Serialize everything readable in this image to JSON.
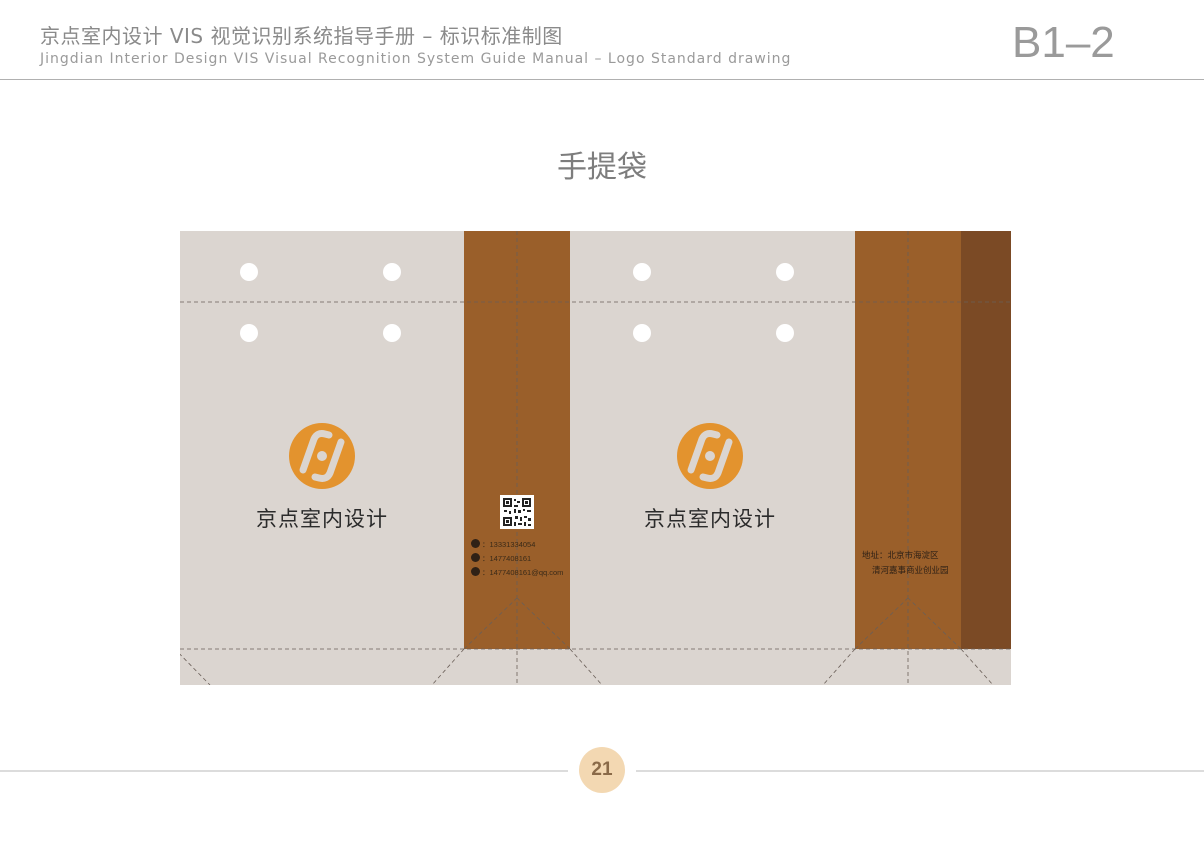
{
  "header": {
    "title_cn": "京点室内设计 VIS 视觉识别系统指导手册 – 标识标准制图",
    "title_en": "Jingdian Interior Design VIS Visual Recognition System Guide Manual – Logo Standard drawing",
    "page_code": "B1–2"
  },
  "section": {
    "title": "手提袋"
  },
  "bag": {
    "brand_name_front": "京点室内设计",
    "brand_name_back": "京点室内设计",
    "contacts": [
      {
        "icon": "phone-icon",
        "text": "：13331334054"
      },
      {
        "icon": "qq-icon",
        "text": "：1477408161"
      },
      {
        "icon": "mail-icon",
        "text": "：1477408161@qq.com"
      }
    ],
    "address_line1": "地址：北京市海淀区",
    "address_line2": "清河嘉事商业创业园"
  },
  "colors": {
    "panel": "#dbd5d0",
    "gusset": "#9a5f2a",
    "glue_flap": "#7b4a25",
    "logo_orange": "#e3932e",
    "page_badge": "#f3d8b2"
  },
  "footer": {
    "page_number": "21"
  }
}
